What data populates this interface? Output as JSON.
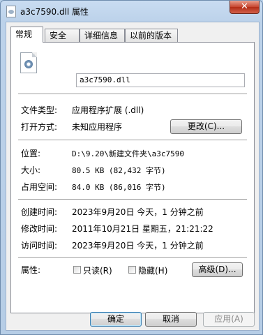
{
  "window": {
    "title": "a3c7590.dll 属性",
    "close_label": "✕"
  },
  "tabs": [
    {
      "label": "常规"
    },
    {
      "label": "安全"
    },
    {
      "label": "详细信息"
    },
    {
      "label": "以前的版本"
    }
  ],
  "general": {
    "file_name": "a3c7590.dll",
    "type_label": "文件类型:",
    "type_value": "应用程序扩展 (.dll)",
    "open_label": "打开方式:",
    "open_value": "未知应用程序",
    "change_button": "更改(C)...",
    "location_label": "位置:",
    "location_value": "D:\\9.20\\新建文件夹\\a3c7590",
    "size_label": "大小:",
    "size_value": "80.5 KB (82,432 字节)",
    "disk_label": "占用空间:",
    "disk_value": "84.0 KB (86,016 字节)",
    "created_label": "创建时间:",
    "created_value": "2023年9月20日 今天，1 分钟之前",
    "modified_label": "修改时间:",
    "modified_value": "2011年10月21日 星期五，21:21:22",
    "accessed_label": "访问时间:",
    "accessed_value": "2023年9月20日 今天，1 分钟之前",
    "attr_label": "属性:",
    "readonly_label": "只读(R)",
    "hidden_label": "隐藏(H)",
    "advanced_button": "高级(D)..."
  },
  "footer": {
    "ok": "确定",
    "cancel": "取消",
    "apply": "应用(A)"
  }
}
